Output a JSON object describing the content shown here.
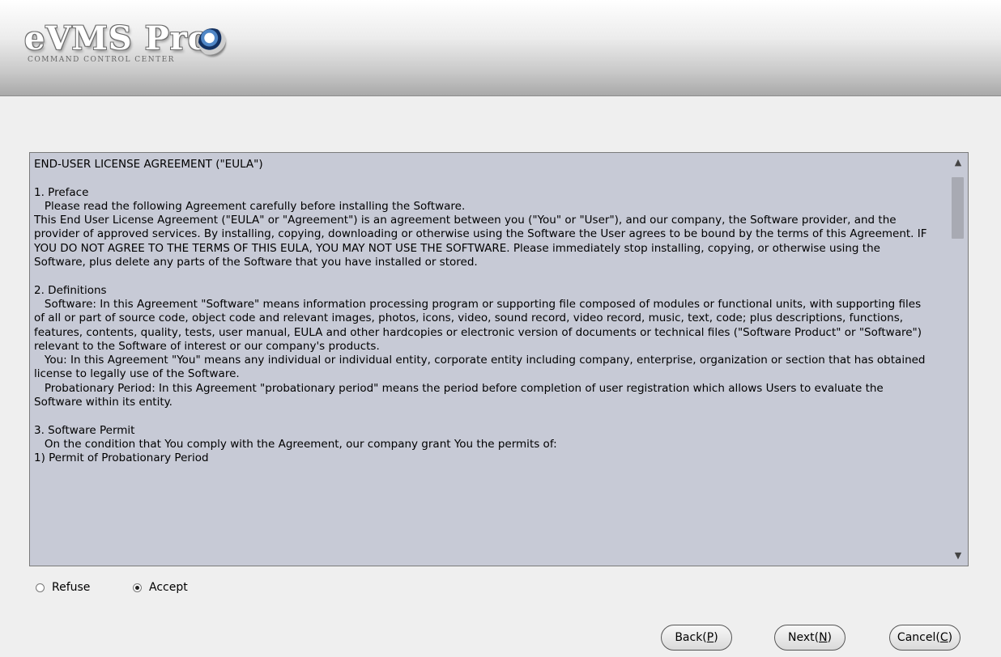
{
  "header": {
    "logo_text": "eVMS Pro",
    "logo_subtitle": "COMMAND CONTROL CENTER"
  },
  "eula": {
    "text": "END-USER LICENSE AGREEMENT (\"EULA\")\n\n1. Preface\n   Please read the following Agreement carefully before installing the Software.\nThis End User License Agreement (\"EULA\" or \"Agreement\") is an agreement between you (\"You\" or \"User\"), and our company, the Software provider, and the provider of approved services. By installing, copying, downloading or otherwise using the Software the User agrees to be bound by the terms of this Agreement. IF YOU DO NOT AGREE TO THE TERMS OF THIS EULA, YOU MAY NOT USE THE SOFTWARE. Please immediately stop installing, copying, or otherwise using the Software, plus delete any parts of the Software that you have installed or stored.\n\n2. Definitions\n   Software: In this Agreement \"Software\" means information processing program or supporting file composed of modules or functional units, with supporting files of all or part of source code, object code and relevant images, photos, icons, video, sound record, video record, music, text, code; plus descriptions, functions, features, contents, quality, tests, user manual, EULA and other hardcopies or electronic version of documents or technical files (\"Software Product\" or \"Software\") relevant to the Software of interest or our company's products.\n   You: In this Agreement \"You\" means any individual or individual entity, corporate entity including company, enterprise, organization or section that has obtained license to legally use of the Software.\n   Probationary Period: In this Agreement \"probationary period\" means the period before completion of user registration which allows Users to evaluate the Software within its entity.\n\n3. Software Permit\n   On the condition that You comply with the Agreement, our company grant You the permits of:\n1) Permit of Probationary Period"
  },
  "options": {
    "refuse_label": "Refuse",
    "accept_label": "Accept",
    "selected": "Accept"
  },
  "buttons": {
    "back": {
      "prefix": "Back(",
      "key": "P",
      "suffix": ")"
    },
    "next": {
      "prefix": "Next(",
      "key": "N",
      "suffix": ")"
    },
    "cancel": {
      "prefix": "Cancel(",
      "key": "C",
      "suffix": ")"
    }
  }
}
